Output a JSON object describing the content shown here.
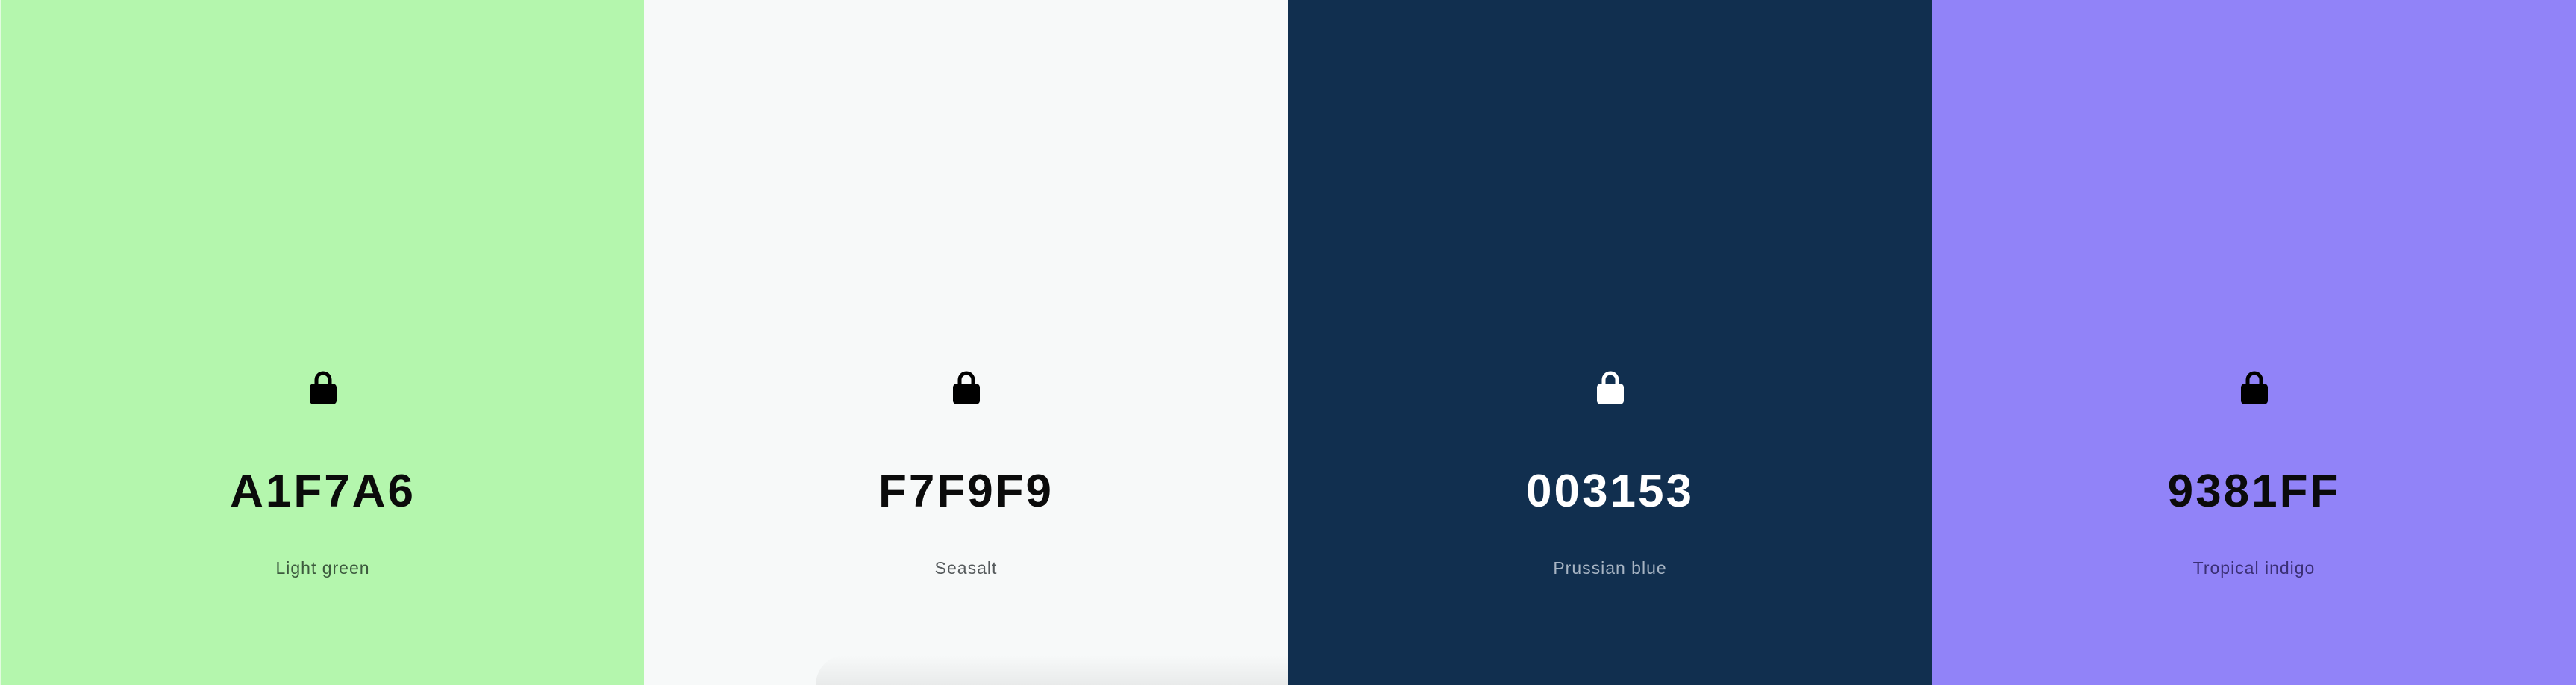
{
  "swatches": [
    {
      "hex": "A1F7A6",
      "name": "Light green",
      "bg": "#b4f6ad",
      "fg": "#0b0b0b",
      "sub": "#3d5a3e",
      "lock": "#000000",
      "icon": "lock-icon"
    },
    {
      "hex": "F7F9F9",
      "name": "Seasalt",
      "bg": "#f7f9f9",
      "fg": "#0b0b0b",
      "sub": "#555a5c",
      "lock": "#000000",
      "icon": "lock-icon"
    },
    {
      "hex": "003153",
      "name": "Prussian blue",
      "bg": "#112f4f",
      "fg": "#ffffff",
      "sub": "#a7b4c3",
      "lock": "#ffffff",
      "icon": "lock-icon"
    },
    {
      "hex": "9381FF",
      "name": "Tropical indigo",
      "bg": "#9183f8",
      "fg": "#0b0b0b",
      "sub": "#3a2f75",
      "lock": "#000000",
      "icon": "lock-icon"
    }
  ]
}
